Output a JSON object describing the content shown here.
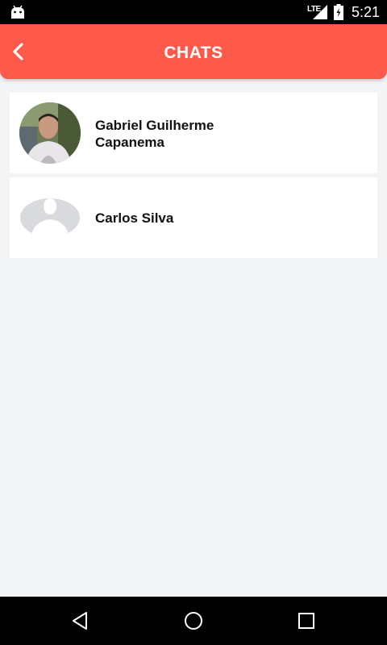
{
  "status_bar": {
    "network": "LTE",
    "time": "5:21",
    "icons": [
      "android-icon",
      "signal-icon",
      "battery-icon"
    ]
  },
  "app_bar": {
    "title": "CHATS",
    "color": "#fe5a4c",
    "back_icon": "chevron-left-icon"
  },
  "chats": [
    {
      "name_line1": "Gabriel Guilherme",
      "name_line2": "Capanema",
      "avatar": "photo"
    },
    {
      "name": "Carlos Silva",
      "avatar": "placeholder"
    }
  ],
  "nav_bar": {
    "buttons": [
      "back-triangle-icon",
      "home-circle-icon",
      "recents-square-icon"
    ]
  }
}
